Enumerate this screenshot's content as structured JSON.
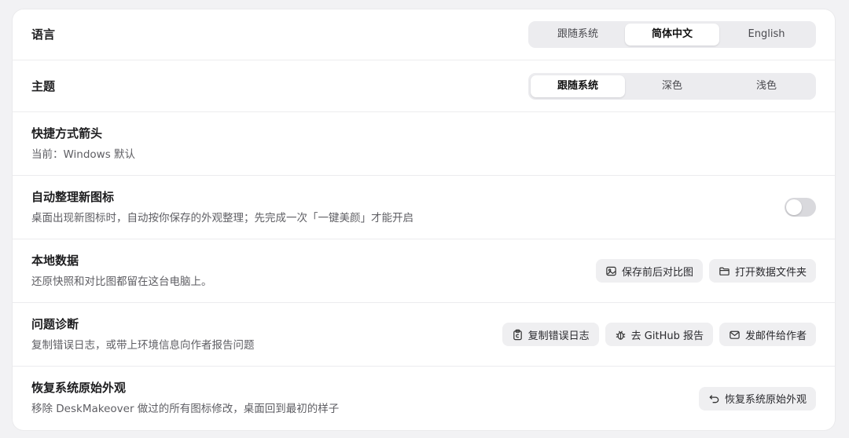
{
  "language": {
    "title": "语言",
    "options": [
      "跟随系统",
      "简体中文",
      "English"
    ],
    "selected": "简体中文"
  },
  "theme": {
    "title": "主题",
    "options": [
      "跟随系统",
      "深色",
      "浅色"
    ],
    "selected": "跟随系统"
  },
  "shortcut_arrow": {
    "title": "快捷方式箭头",
    "desc": "当前：Windows 默认"
  },
  "auto_arrange": {
    "title": "自动整理新图标",
    "desc": "桌面出现新图标时，自动按你保存的外观整理；先完成一次「一键美颜」才能开启",
    "enabled": false
  },
  "local_data": {
    "title": "本地数据",
    "desc": "还原快照和对比图都留在这台电脑上。",
    "buttons": {
      "compare": "保存前后对比图",
      "open_folder": "打开数据文件夹"
    }
  },
  "diagnostics": {
    "title": "问题诊断",
    "desc": "复制错误日志，或带上环境信息向作者报告问题",
    "buttons": {
      "copy_log": "复制错误日志",
      "github": "去 GitHub 报告",
      "email": "发邮件给作者"
    }
  },
  "restore": {
    "title": "恢复系统原始外观",
    "desc": "移除 DeskMakeover 做过的所有图标修改，桌面回到最初的样子",
    "button": "恢复系统原始外观"
  }
}
